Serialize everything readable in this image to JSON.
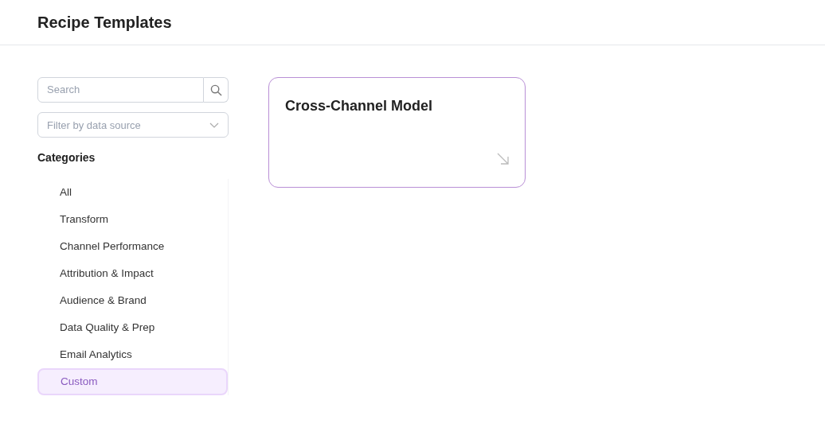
{
  "header": {
    "title": "Recipe Templates"
  },
  "search": {
    "placeholder": "Search"
  },
  "filter": {
    "placeholder": "Filter by data source"
  },
  "categories": {
    "heading": "Categories",
    "items": [
      {
        "label": "All",
        "selected": false
      },
      {
        "label": "Transform",
        "selected": false
      },
      {
        "label": "Channel Performance",
        "selected": false
      },
      {
        "label": "Attribution & Impact",
        "selected": false
      },
      {
        "label": "Audience & Brand",
        "selected": false
      },
      {
        "label": "Data Quality & Prep",
        "selected": false
      },
      {
        "label": "Email Analytics",
        "selected": false
      },
      {
        "label": "Custom",
        "selected": true
      }
    ]
  },
  "templates": [
    {
      "title": "Cross-Channel Model"
    }
  ]
}
